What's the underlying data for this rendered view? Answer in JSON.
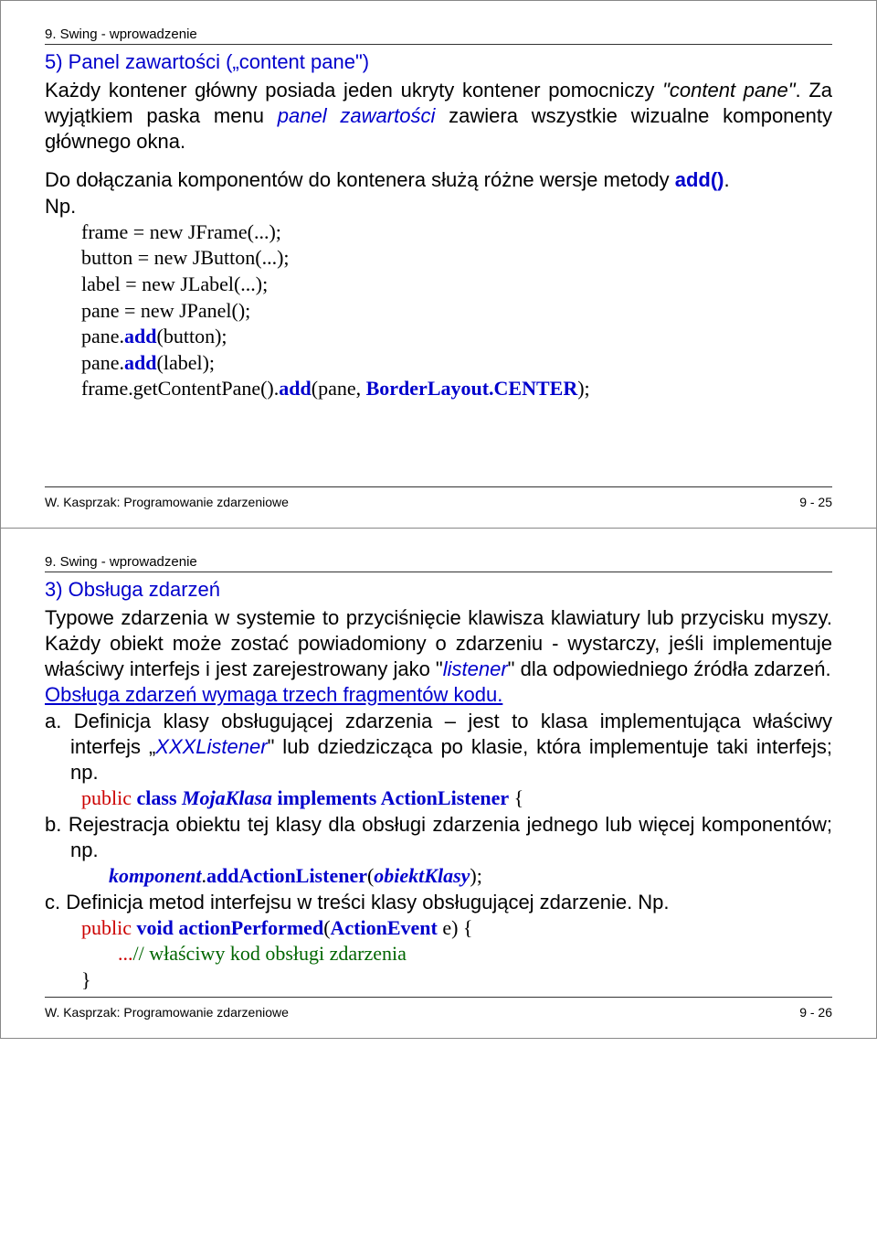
{
  "page1": {
    "header": "9. Swing - wprowadzenie",
    "title": "5) Panel zawartości („content pane\")",
    "p1_a": "Każdy kontener główny posiada jeden ukryty kontener pomocniczy ",
    "p1_b": "\"content pane\"",
    "p1_c": ". Za wyjątkiem paska menu ",
    "p1_d": "panel zawartości",
    "p1_e": " zawiera wszystkie wizualne komponenty głównego okna.",
    "p2_a": "Do dołączania komponentów do kontenera służą różne wersje metody ",
    "p2_b": "add()",
    "p2_c": ".",
    "np": "Np.",
    "code": {
      "l1": "frame = new JFrame(...);",
      "l2": "button = new JButton(...);",
      "l3": "label = new JLabel(...);",
      "l4": "pane = new JPanel();",
      "l5a": "pane.",
      "l5b": "add",
      "l5c": "(button);",
      "l6a": "pane.",
      "l6b": "add",
      "l6c": "(label);",
      "l7a": "frame.getContentPane().",
      "l7b": "add",
      "l7c": "(pane, ",
      "l7d": "BorderLayout.CENTER",
      "l7e": ");"
    },
    "footer_left": "W. Kasprzak: Programowanie zdarzeniowe",
    "footer_right": "9 - 25"
  },
  "page2": {
    "header": "9. Swing - wprowadzenie",
    "title": "3) Obsługa zdarzeń",
    "p1_a": "Typowe zdarzenia w systemie to przyciśnięcie klawisza klawiatury lub przycisku myszy. Każdy obiekt może zostać powiadomiony o zdarzeniu - wystarczy, jeśli implementuje właściwy interfejs i jest zarejestrowany jako \"",
    "p1_b": "listener",
    "p1_c": "\" dla odpowiedniego źródła zdarzeń.",
    "p2": "Obsługa zdarzeń wymaga trzech fragmentów kodu.",
    "a_pre": "a. Definicja klasy obsługującej zdarzenia – jest to klasa implementująca właściwy interfejs „",
    "a_mid": "XXXListener",
    "a_post": "\" lub dziedzicząca po klasie, która implementuje taki interfejs; np.",
    "a_code_1": "public ",
    "a_code_2": "class ",
    "a_code_3": "MojaKlasa",
    "a_code_4": " implements ",
    "a_code_5": "ActionListener",
    "a_code_6": " {",
    "b": "b. Rejestracja obiektu tej klasy dla obsługi zdarzenia jednego lub więcej komponentów; np.",
    "b_code_1": "komponent",
    "b_code_2": ".",
    "b_code_3": "addActionListener",
    "b_code_4": "(",
    "b_code_5": "obiektKlasy",
    "b_code_6": ");",
    "c": "c. Definicja metod interfejsu w treści klasy obsługującej zdarzenie. Np.",
    "c_code_l1_a": "public ",
    "c_code_l1_b": "void ",
    "c_code_l1_c": "actionPerformed",
    "c_code_l1_d": "(",
    "c_code_l1_e": "ActionEvent",
    "c_code_l1_f": " e) {",
    "c_code_l2_a": "...",
    "c_code_l2_b": "// właściwy kod obsługi zdarzenia",
    "c_code_l3": "}",
    "footer_left": "W. Kasprzak: Programowanie zdarzeniowe",
    "footer_right": "9 - 26"
  }
}
